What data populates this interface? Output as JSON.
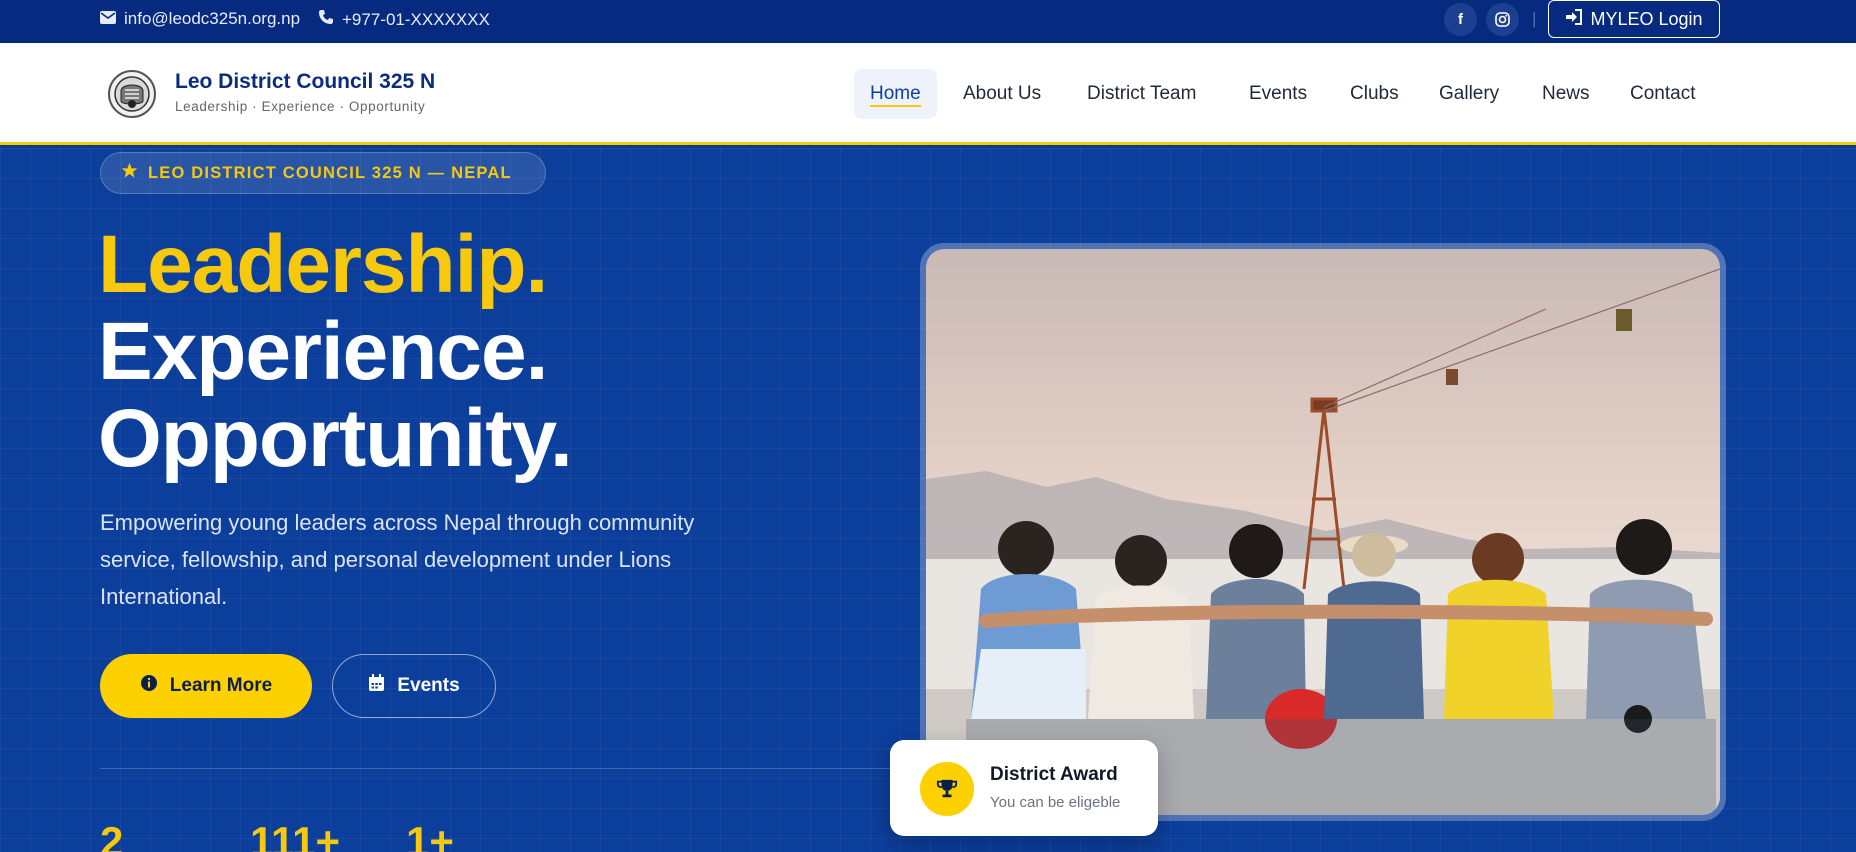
{
  "topbar": {
    "email": "info@leodc325n.org.np",
    "phone": "+977-01-XXXXXXX",
    "social_icons": [
      "facebook-icon",
      "instagram-icon"
    ],
    "separator": "|",
    "login_label": "MYLEO Login"
  },
  "header": {
    "brand_title": "Leo District Council 325 N",
    "brand_subtitle": "Leadership · Experience · Opportunity",
    "nav": [
      {
        "label": "Home",
        "active": true
      },
      {
        "label": "About Us"
      },
      {
        "label": "District Team"
      },
      {
        "label": "Events"
      },
      {
        "label": "Clubs"
      },
      {
        "label": "Gallery"
      },
      {
        "label": "News"
      },
      {
        "label": "Contact"
      }
    ]
  },
  "hero": {
    "badge": "LEO DISTRICT COUNCIL 325 N — NEPAL",
    "headline": [
      "Leadership.",
      "Experience.",
      "Opportunity."
    ],
    "description": "Empowering young leaders across Nepal through community service, fellowship, and personal development under Lions International.",
    "primary_button": "Learn More",
    "secondary_button": "Events",
    "stats": [
      "2",
      "111+",
      "1+"
    ]
  },
  "award_card": {
    "title": "District Award",
    "subtitle": "You can be eligeble",
    "icon": "trophy-icon"
  },
  "colors": {
    "brand_blue": "#0c3e9b",
    "topbar_blue": "#062a80",
    "accent_yellow": "#f6c90e",
    "nav_text": "#1f2937"
  }
}
